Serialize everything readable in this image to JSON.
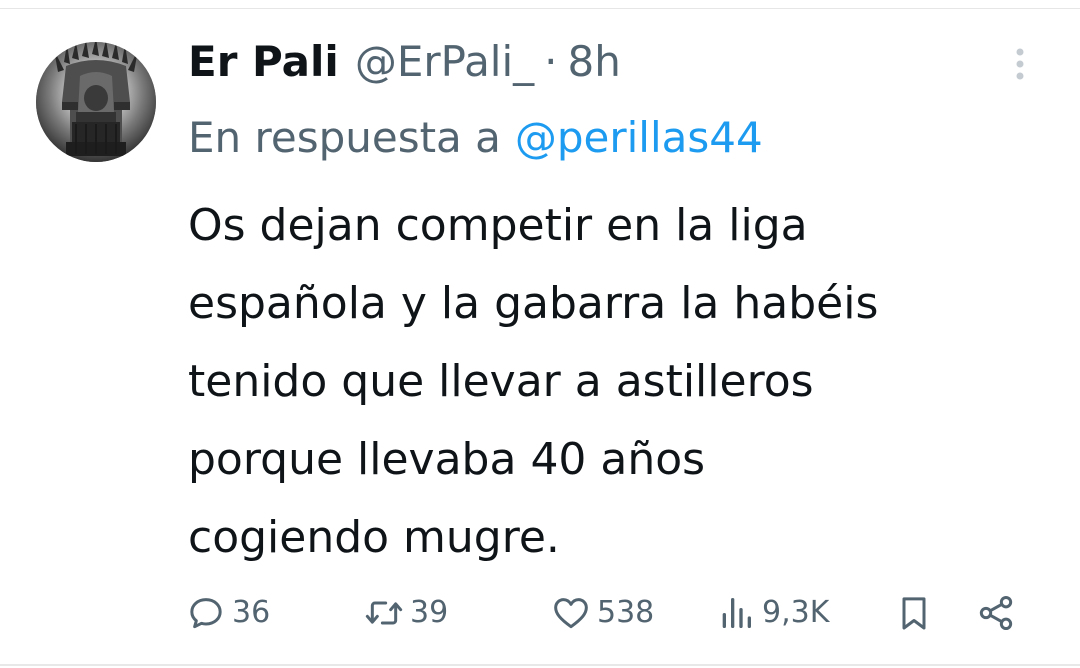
{
  "author": {
    "display_name": "Er Pali",
    "handle": "@ErPali_",
    "separator": "·",
    "time": "8h",
    "avatar_icon": "iron-throne-avatar"
  },
  "reply": {
    "prefix": "En respuesta a",
    "to_handle": "@perillas44"
  },
  "tweet": {
    "text": "Os dejan competir en la liga\nespañola y la gabarra la habéis\ntenido que llevar a astilleros\nporque llevaba 40 años\ncogiendo mugre."
  },
  "actions": {
    "replies": "36",
    "retweets": "39",
    "likes": "538",
    "views": "9,3K"
  },
  "icons": {
    "more": "more-vertical-icon",
    "reply": "reply-icon",
    "retweet": "retweet-icon",
    "like": "heart-icon",
    "views": "views-icon",
    "bookmark": "bookmark-icon",
    "share": "share-icon"
  },
  "colors": {
    "text": "#0f1419",
    "secondary": "#536471",
    "link": "#1d9bf0",
    "more_dots": "#c4cbd1"
  }
}
